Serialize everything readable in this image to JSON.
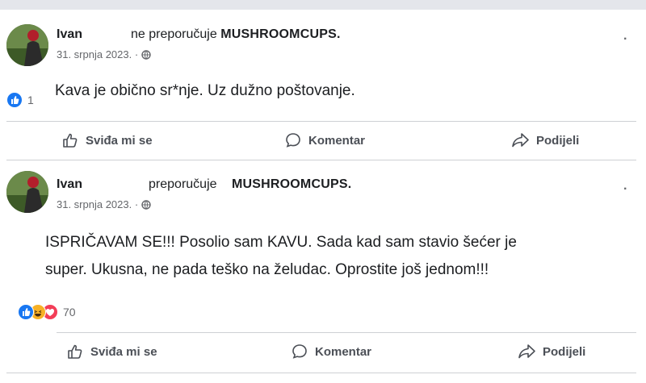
{
  "posts": [
    {
      "author": "Ivan",
      "verb": "ne preporučuje",
      "page": "MUSHROOMCUPS.",
      "date": "31. srpnja 2023. ·",
      "menu": "·",
      "text_lines": [
        "Kava je obično sr*nje. Uz dužno poštovanje."
      ],
      "reaction_count": "1",
      "reaction_icons": [
        "like-icon"
      ],
      "actions": {
        "like": "Sviđa mi se",
        "comment": "Komentar",
        "share": "Podijeli"
      }
    },
    {
      "author": "Ivan",
      "verb": "preporučuje",
      "page": "MUSHROOMCUPS.",
      "date": "31. srpnja 2023. ·",
      "menu": "·",
      "text_lines": [
        "ISPRIČAVAM SE!!! Posolio sam KAVU. Sada kad sam stavio šećer je",
        "super.  Ukusna, ne pada teško na želudac. Oprostite još jednom!!!"
      ],
      "reaction_count": "70",
      "reaction_icons": [
        "like-icon",
        "haha-icon",
        "love-icon"
      ],
      "actions": {
        "like": "Sviđa mi se",
        "comment": "Komentar",
        "share": "Podijeli"
      }
    }
  ],
  "colors": {
    "like": "#1877f2",
    "love": "#f33e58",
    "haha": "#f7b125",
    "muted": "#65676b"
  }
}
